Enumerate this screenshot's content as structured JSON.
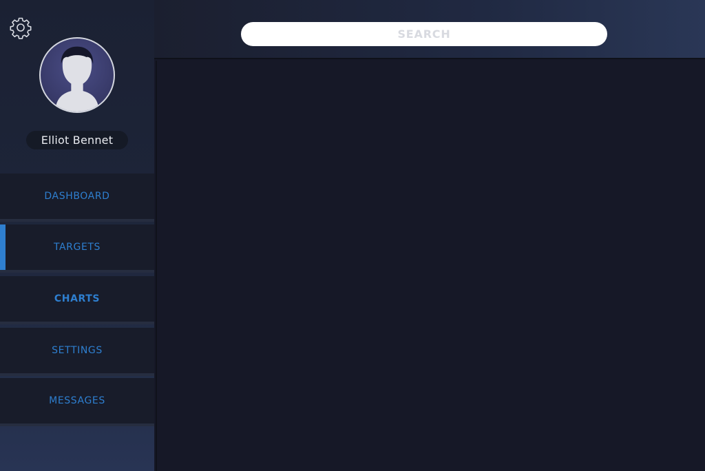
{
  "user": {
    "name": "Elliot Bennet"
  },
  "search": {
    "placeholder": "SEARCH",
    "value": ""
  },
  "nav": {
    "items": [
      {
        "label": "DASHBOARD"
      },
      {
        "label": "TARGETS"
      },
      {
        "label": "CHARTS"
      },
      {
        "label": "SETTINGS"
      },
      {
        "label": "MESSAGES"
      }
    ]
  },
  "colors": {
    "accent": "#2f7fcf",
    "sidebar": "#181c2a",
    "content": "#161827"
  },
  "icons": {
    "settings": "gear-icon",
    "avatar": "user-silhouette-icon"
  }
}
